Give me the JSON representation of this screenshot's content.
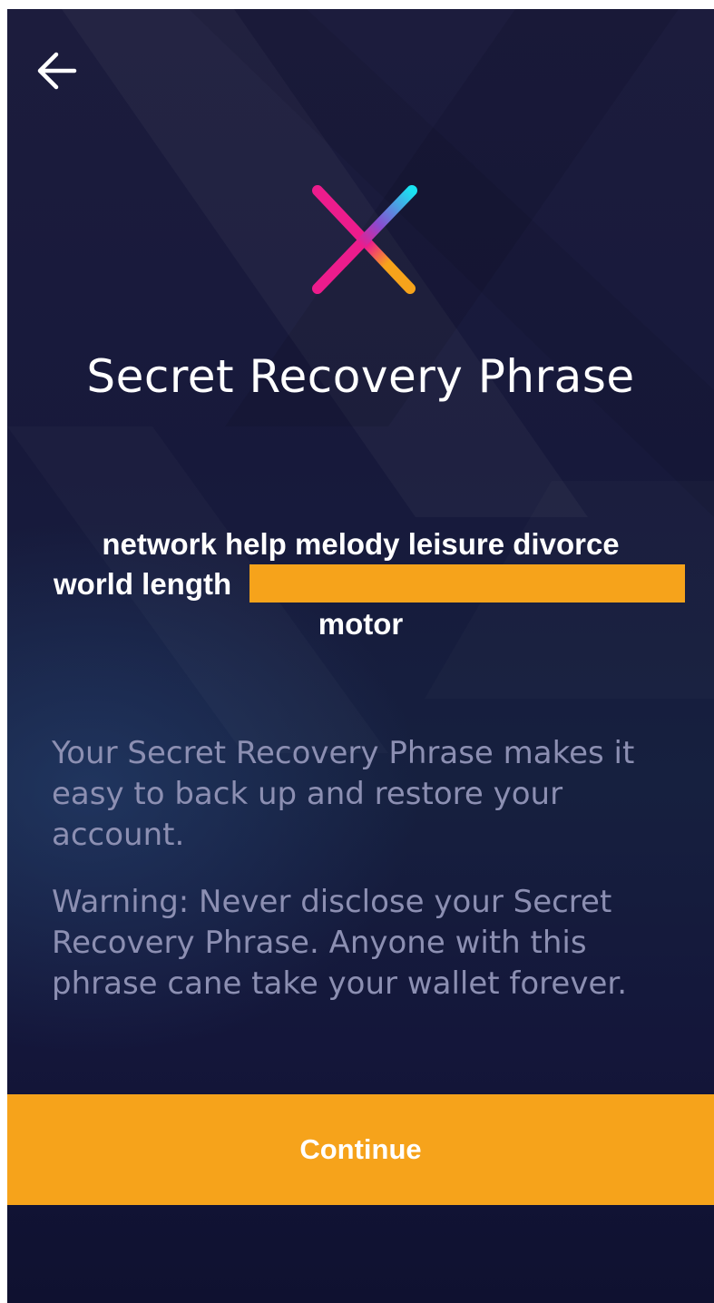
{
  "nav": {
    "back_icon": "arrow-left-icon"
  },
  "brand": {
    "logo_icon": "x-logo-icon",
    "colors": {
      "pink": "#ec1c8c",
      "cyan": "#19e3f2",
      "orange": "#f6a31b"
    }
  },
  "header": {
    "title": "Secret Recovery Phrase"
  },
  "phrase": {
    "line1": "network help melody leisure divorce",
    "line2": "world length",
    "line3": "motor",
    "redaction_color": "#f6a31b"
  },
  "info": {
    "description": "Your Secret Recovery Phrase makes it easy to back up and restore your account.",
    "warning": "Warning: Never disclose your Secret Recovery Phrase. Anyone with this phrase cane take your wallet forever."
  },
  "actions": {
    "continue_label": "Continue",
    "accent_color": "#f6a31b"
  }
}
